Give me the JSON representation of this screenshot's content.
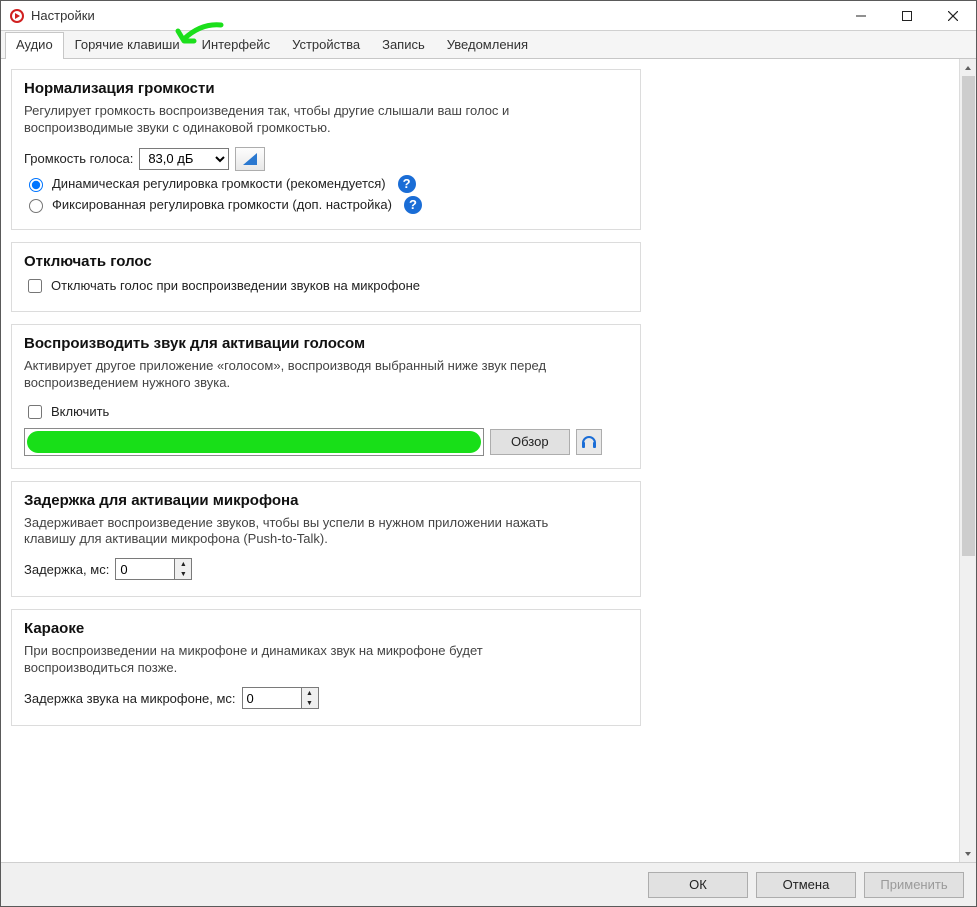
{
  "window": {
    "title": "Настройки"
  },
  "tabs": [
    "Аудио",
    "Горячие клавиши",
    "Интерфейс",
    "Устройства",
    "Запись",
    "Уведомления"
  ],
  "active_tab": 0,
  "groups": {
    "normalization": {
      "title": "Нормализация громкости",
      "desc": "Регулирует громкость воспроизведения так, чтобы другие слышали ваш голос и воспроизводимые звуки с одинаковой громкостью.",
      "voice_volume_label": "Громкость голоса:",
      "voice_volume_value": "83,0 дБ",
      "radio_dynamic": "Динамическая регулировка громкости (рекомендуется)",
      "radio_fixed": "Фиксированная регулировка громкости (доп. настройка)"
    },
    "mute": {
      "title": "Отключать голос",
      "check_label": "Отключать голос при воспроизведении звуков на микрофоне"
    },
    "activation_sound": {
      "title": "Воспроизводить звук для активации голосом",
      "desc": "Активирует другое приложение «голосом», воспроизводя выбранный ниже звук перед воспроизведением нужного звука.",
      "enable_label": "Включить",
      "browse_label": "Обзор"
    },
    "mic_delay": {
      "title": "Задержка для активации микрофона",
      "desc": "Задерживает воспроизведение звуков, чтобы вы успели в нужном приложении нажать клавишу для активации микрофона (Push-to-Talk).",
      "delay_label": "Задержка, мс:",
      "delay_value": "0"
    },
    "karaoke": {
      "title": "Караоке",
      "desc": "При воспроизведении на микрофоне и динамиках звук на микрофоне будет воспроизводиться позже.",
      "delay_label": "Задержка звука на микрофоне, мс:",
      "delay_value": "0"
    }
  },
  "footer": {
    "ok": "ОК",
    "cancel": "Отмена",
    "apply": "Применить"
  }
}
